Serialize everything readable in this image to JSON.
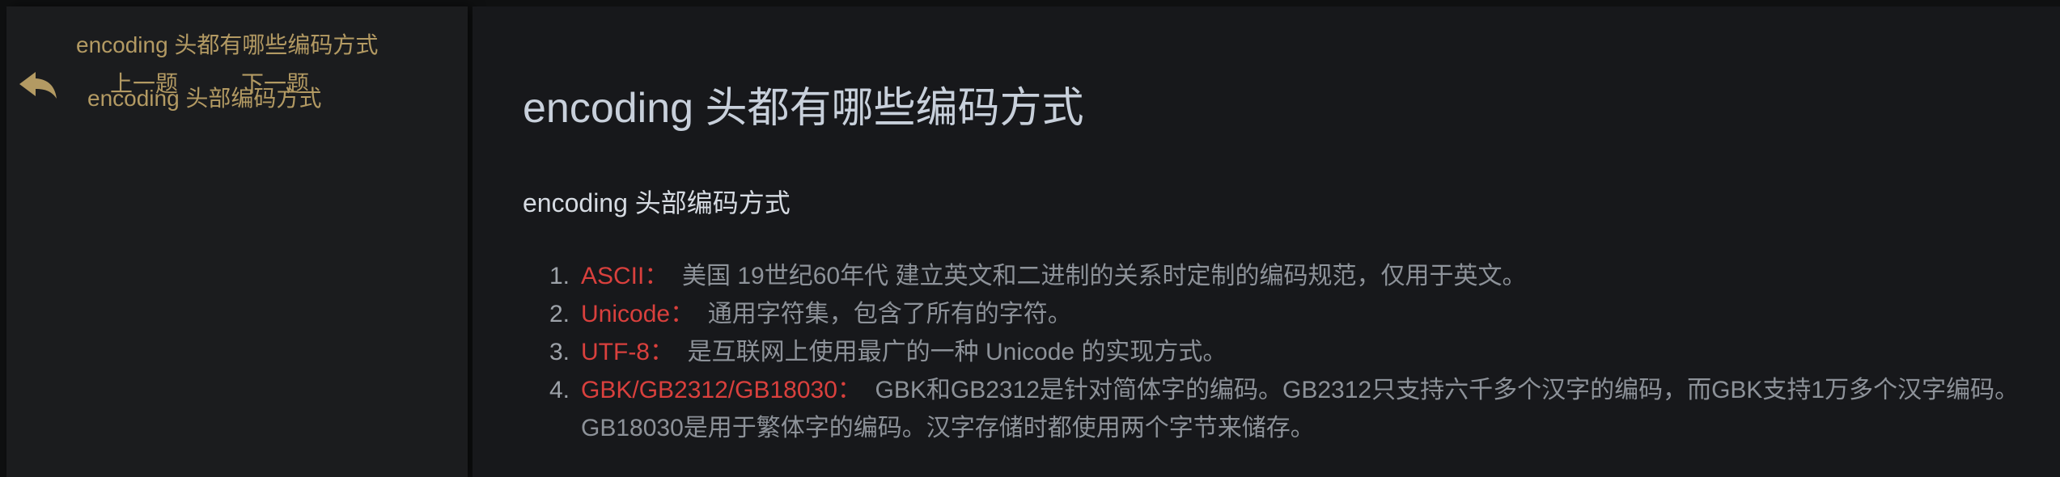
{
  "nav": {
    "top_title": "encoding 头都有哪些编码方式",
    "back_icon": "back-arrow-icon",
    "prev_label": "上一题",
    "next_label": "下一题",
    "current_title": "encoding 头部编码方式"
  },
  "article": {
    "title": "encoding 头都有哪些编码方式",
    "section_title": "encoding 头部编码方式",
    "items": [
      {
        "num": "1.",
        "term": "ASCII：",
        "desc": "美国 19世纪60年代 建立英文和二进制的关系时定制的编码规范，仅用于英文。"
      },
      {
        "num": "2.",
        "term": "Unicode：",
        "desc": "通用字符集，包含了所有的字符。"
      },
      {
        "num": "3.",
        "term": "UTF-8：",
        "desc": "是互联网上使用最广的一种 Unicode 的实现方式。"
      },
      {
        "num": "4.",
        "term": "GBK/GB2312/GB18030：",
        "desc": "GBK和GB2312是针对简体字的编码。GB2312只支持六千多个汉字的编码，而GBK支持1万多个汉字编码。GB18030是用于繁体字的编码。汉字存储时都使用两个字节来储存。"
      }
    ]
  },
  "colors": {
    "nav_gold": "#b39a63",
    "term_red": "#d9403d",
    "body_text": "#8d9299",
    "heading": "#c8d0db",
    "background": "#17181b"
  }
}
